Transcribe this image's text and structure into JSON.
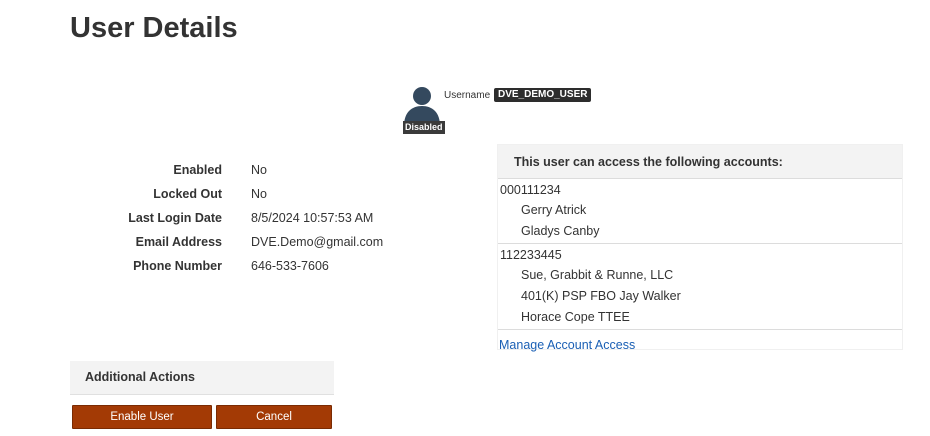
{
  "page": {
    "title": "User Details"
  },
  "profile": {
    "status_badge": "Disabled",
    "username_label": "Username",
    "username": "DVE_DEMO_USER",
    "avatar_icon": "user-silhouette-icon"
  },
  "details": [
    {
      "label": "Enabled",
      "value": "No"
    },
    {
      "label": "Locked Out",
      "value": "No"
    },
    {
      "label": "Last Login Date",
      "value": "8/5/2024 10:57:53 AM"
    },
    {
      "label": "Email Address",
      "value": "DVE.Demo@gmail.com"
    },
    {
      "label": "Phone Number",
      "value": "646-533-7606"
    }
  ],
  "accounts": {
    "header": "This user can access the following accounts:",
    "groups": [
      {
        "number": "000111234",
        "holders": [
          "Gerry Atrick",
          "Gladys Canby"
        ]
      },
      {
        "number": "112233445",
        "holders": [
          "Sue, Grabbit & Runne, LLC",
          "401(K) PSP FBO Jay Walker",
          "Horace Cope TTEE"
        ]
      }
    ],
    "manage_link": "Manage Account Access"
  },
  "actions": {
    "title": "Additional Actions",
    "enable_label": "Enable User",
    "cancel_label": "Cancel"
  },
  "colors": {
    "button_bg": "#a33a05",
    "link": "#1a5fb4",
    "avatar": "#34495e"
  }
}
